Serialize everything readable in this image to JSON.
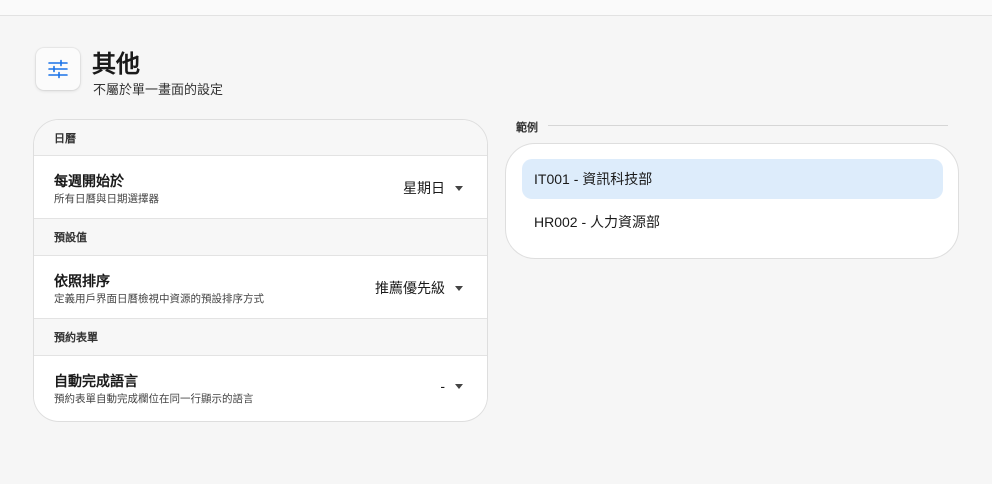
{
  "header": {
    "title": "其他",
    "subtitle": "不屬於單一畫面的設定",
    "icon": "sliders-icon",
    "accent": "#1a73e8"
  },
  "settings": {
    "sections": [
      {
        "header": "日曆",
        "row": {
          "title": "每週開始於",
          "description": "所有日曆與日期選擇器",
          "value": "星期日"
        }
      },
      {
        "header": "預設值",
        "row": {
          "title": "依照排序",
          "description": "定義用戶界面日曆檢視中資源的預設排序方式",
          "value": "推薦優先級"
        }
      },
      {
        "header": "預約表單",
        "row": {
          "title": "自動完成語言",
          "description": "預約表單自動完成欄位在同一行顯示的語言",
          "value": "-"
        }
      }
    ]
  },
  "example": {
    "label": "範例",
    "items": [
      {
        "text": "IT001 - 資訊科技部",
        "selected": true
      },
      {
        "text": "HR002 - 人力資源部",
        "selected": false
      }
    ],
    "selected_color": "#ddecfb"
  }
}
